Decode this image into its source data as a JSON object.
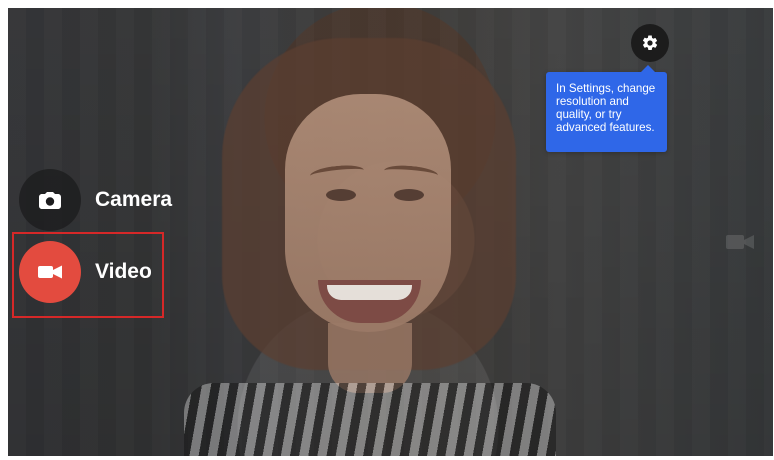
{
  "app": {
    "modes": [
      {
        "label": "Camera",
        "icon": "camera-icon"
      },
      {
        "label": "Video",
        "icon": "video-icon",
        "selected": true
      }
    ],
    "tooltip": {
      "text": "In Settings, change resolution and quality, or try advanced features."
    },
    "icons": {
      "settings": "gear-icon",
      "ghost_video": "video-icon"
    },
    "colors": {
      "video_accent": "#e34b3f",
      "tooltip_bg": "#2f67e8",
      "highlight_border": "#d62828"
    }
  }
}
